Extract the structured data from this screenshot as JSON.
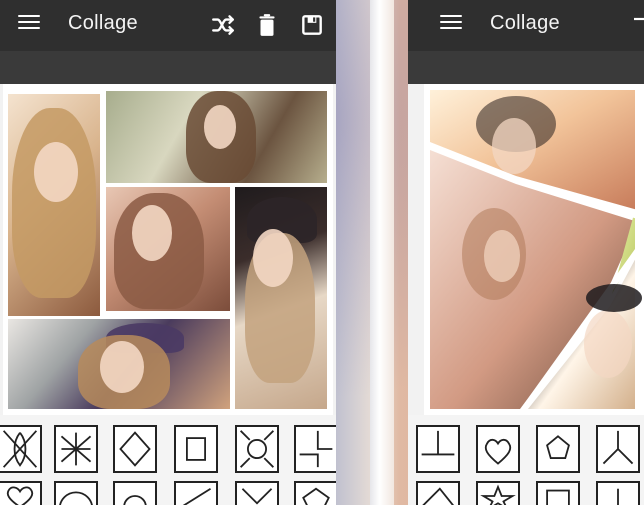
{
  "screens": [
    {
      "toolbar": {
        "title": "Collage",
        "icons": [
          "menu-icon",
          "shuffle-icon",
          "trash-icon",
          "save-icon"
        ]
      },
      "canvas": {
        "photos": [
          "portrait-blonde",
          "woman-in-forest",
          "woman-curly-hair",
          "woman-beanie",
          "woman-purple-hat"
        ]
      },
      "layout_tray": {
        "tiles": [
          "layout-tile-1",
          "layout-tile-2",
          "layout-tile-3",
          "layout-tile-4",
          "layout-tile-5",
          "layout-tile-6"
        ]
      }
    },
    {
      "toolbar": {
        "title": "Collage",
        "icons": [
          "menu-icon"
        ]
      },
      "canvas": {
        "photos": [
          "woman-beanie-sunlight",
          "woman-wavy-hair",
          "woman-dark-beanie",
          "lime-accent-frame"
        ]
      },
      "layout_tray": {
        "tiles": [
          "layout-tile-1",
          "layout-tile-2",
          "layout-tile-3",
          "layout-tile-4"
        ]
      }
    }
  ],
  "colors": {
    "toolbar_bg": "#2f2f2f",
    "subbar_bg": "#3a3a3a",
    "tray_bg": "#f4f4f4",
    "tile_stroke": "#222222",
    "title_text": "#f4f4f4"
  }
}
